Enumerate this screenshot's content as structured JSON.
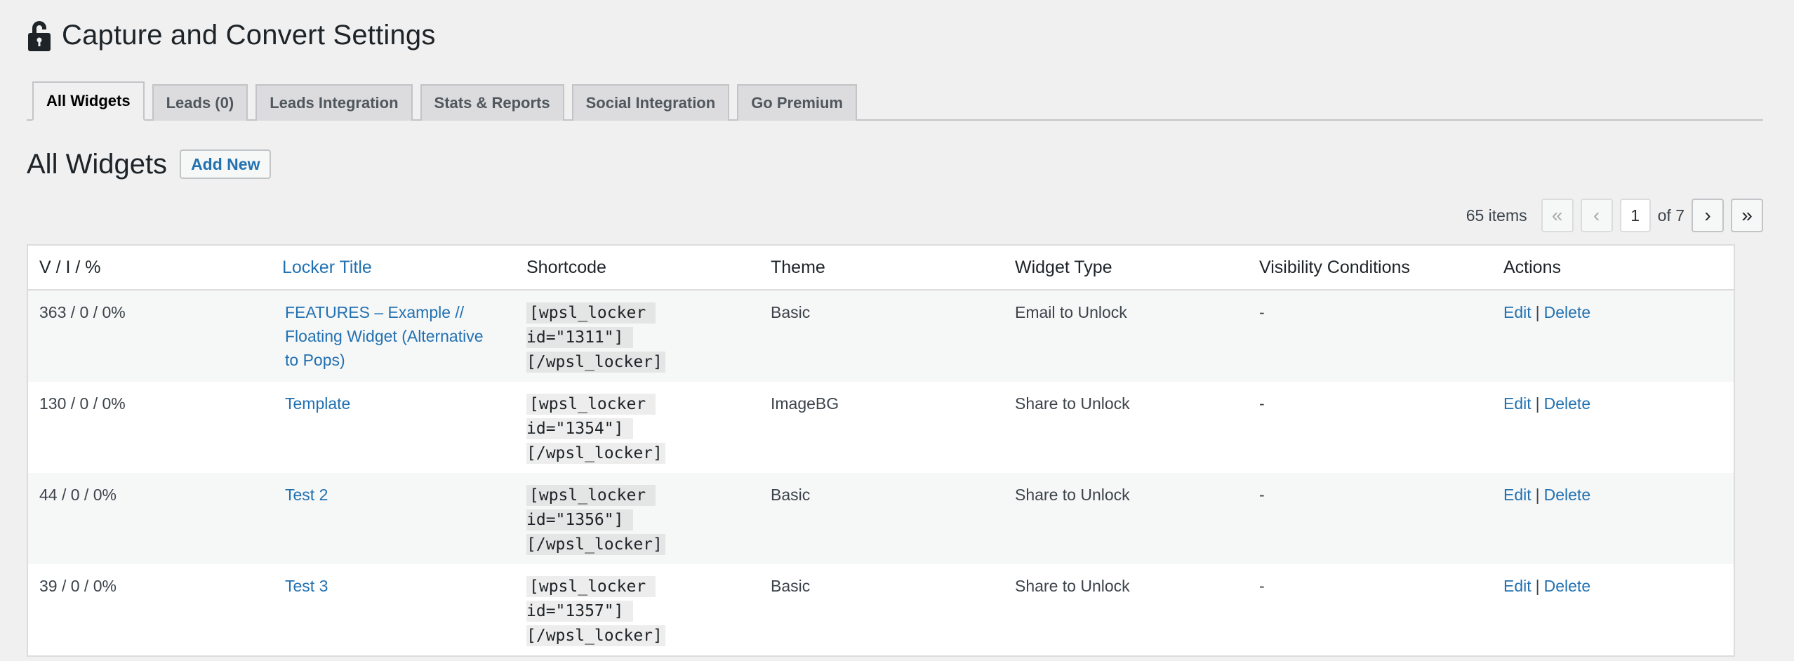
{
  "header": {
    "title": "Capture and Convert Settings",
    "icon": "lock-icon"
  },
  "tabs": [
    {
      "label": "All Widgets",
      "active": true
    },
    {
      "label": "Leads (0)",
      "active": false
    },
    {
      "label": "Leads Integration",
      "active": false
    },
    {
      "label": "Stats & Reports",
      "active": false
    },
    {
      "label": "Social Integration",
      "active": false
    },
    {
      "label": "Go Premium",
      "active": false
    }
  ],
  "section": {
    "title": "All Widgets",
    "add_new_label": "Add New"
  },
  "pagination": {
    "items_label": "65 items",
    "first": "«",
    "prev": "‹",
    "current_page": "1",
    "of_label": "of 7",
    "next": "›",
    "last": "»"
  },
  "table": {
    "columns": [
      "V / I / %",
      "Locker Title",
      "Shortcode",
      "Theme",
      "Widget Type",
      "Visibility Conditions",
      "Actions"
    ],
    "rows": [
      {
        "stats": "363 / 0 / 0%",
        "title": "FEATURES – Example // Floating Widget (Alternative to Pops)",
        "shortcode": "[wpsl_locker id=\"1311\"] [/wpsl_locker]",
        "theme": "Basic",
        "widget_type": "Email to Unlock",
        "visibility": "-",
        "edit": "Edit",
        "delete": "Delete"
      },
      {
        "stats": "130 / 0 / 0%",
        "title": "Template",
        "shortcode": "[wpsl_locker id=\"1354\"] [/wpsl_locker]",
        "theme": "ImageBG",
        "widget_type": "Share to Unlock",
        "visibility": "-",
        "edit": "Edit",
        "delete": "Delete"
      },
      {
        "stats": "44 / 0 / 0%",
        "title": "Test 2",
        "shortcode": "[wpsl_locker id=\"1356\"] [/wpsl_locker]",
        "theme": "Basic",
        "widget_type": "Share to Unlock",
        "visibility": "-",
        "edit": "Edit",
        "delete": "Delete"
      },
      {
        "stats": "39 / 0 / 0%",
        "title": "Test 3",
        "shortcode": "[wpsl_locker id=\"1357\"] [/wpsl_locker]",
        "theme": "Basic",
        "widget_type": "Share to Unlock",
        "visibility": "-",
        "edit": "Edit",
        "delete": "Delete"
      }
    ],
    "action_separator": "|"
  },
  "colors": {
    "background": "#f0f0f1",
    "link": "#2271b1",
    "text": "#1d2327",
    "row_alt": "#f6f7f7",
    "border": "#dcdcde"
  }
}
